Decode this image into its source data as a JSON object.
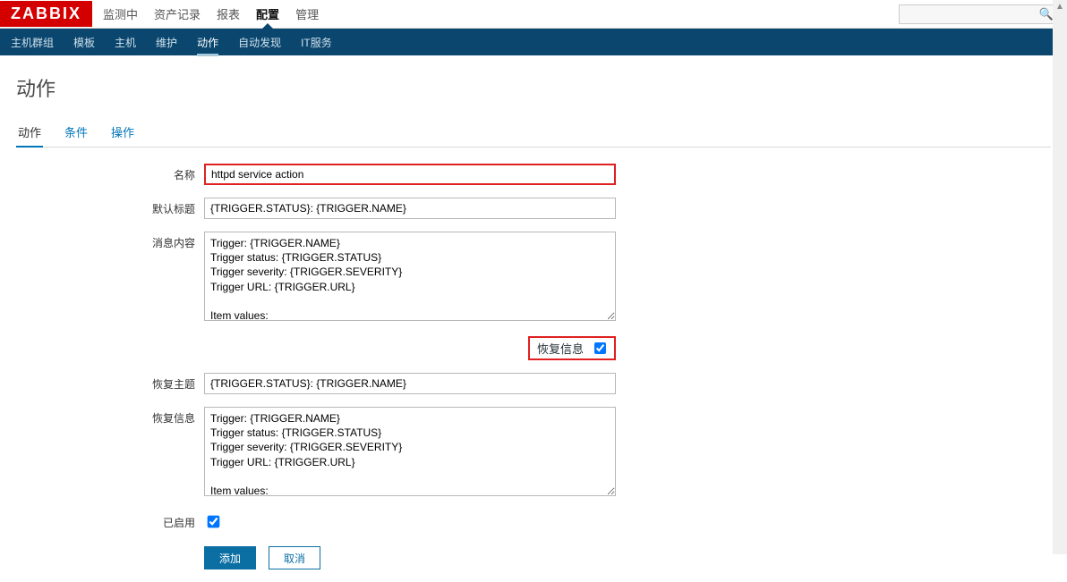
{
  "brand": "ZABBIX",
  "topnav": {
    "items": [
      "监测中",
      "资产记录",
      "报表",
      "配置",
      "管理"
    ],
    "active_index": 3
  },
  "search": {
    "icon": "🔍"
  },
  "subnav": {
    "items": [
      "主机群组",
      "模板",
      "主机",
      "维护",
      "动作",
      "自动发现",
      "IT服务"
    ],
    "active_index": 4
  },
  "page": {
    "title": "动作"
  },
  "tabs": {
    "items": [
      "动作",
      "条件",
      "操作"
    ],
    "active_index": 0
  },
  "form": {
    "name_label": "名称",
    "name_value": "httpd service action",
    "subject_label": "默认标题",
    "subject_value": "{TRIGGER.STATUS}: {TRIGGER.NAME}",
    "message_label": "消息内容",
    "message_value": "Trigger: {TRIGGER.NAME}\nTrigger status: {TRIGGER.STATUS}\nTrigger severity: {TRIGGER.SEVERITY}\nTrigger URL: {TRIGGER.URL}\n\nItem values:",
    "recovery_checkbox_label": "恢复信息",
    "recovery_checked": true,
    "recovery_subject_label": "恢复主题",
    "recovery_subject_value": "{TRIGGER.STATUS}: {TRIGGER.NAME}",
    "recovery_message_label": "恢复信息",
    "recovery_message_value": "Trigger: {TRIGGER.NAME}\nTrigger status: {TRIGGER.STATUS}\nTrigger severity: {TRIGGER.SEVERITY}\nTrigger URL: {TRIGGER.URL}\n\nItem values:",
    "enabled_label": "已启用",
    "enabled_checked": true,
    "add_button": "添加",
    "cancel_button": "取消"
  }
}
